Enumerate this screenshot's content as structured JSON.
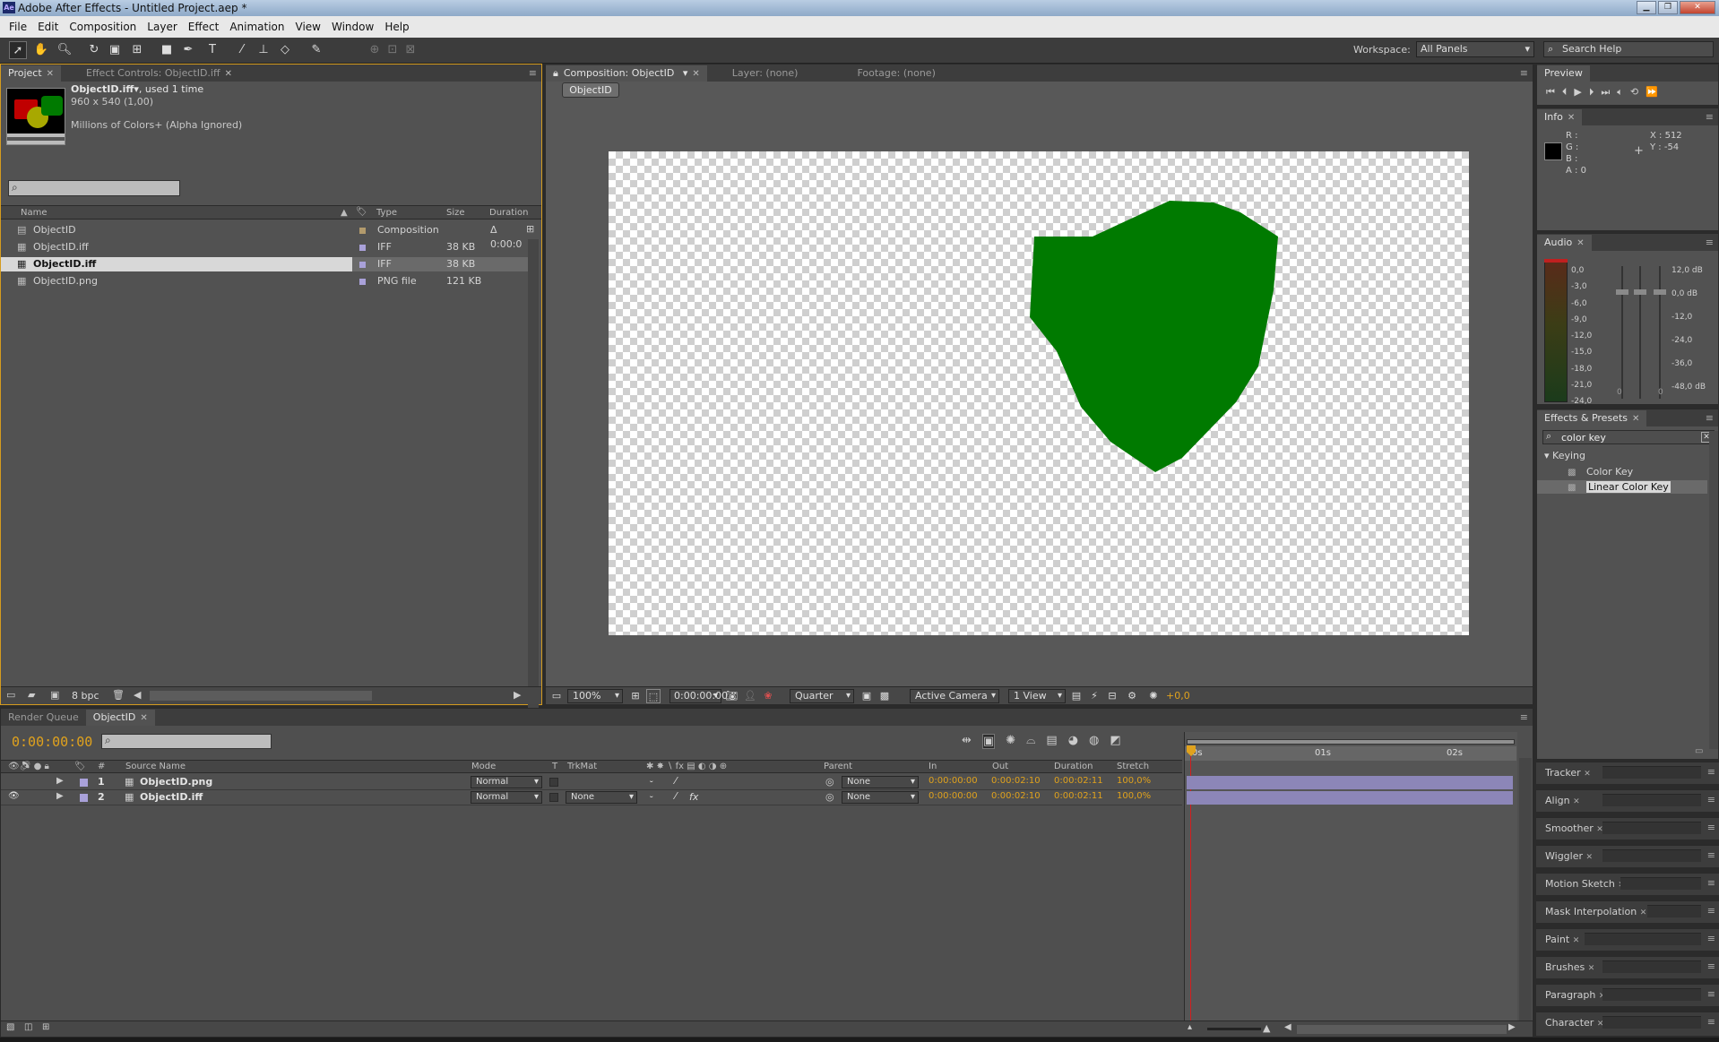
{
  "window": {
    "app_icon": "Ae",
    "title": "Adobe After Effects - Untitled Project.aep *",
    "controls": [
      "minimize",
      "restore",
      "close"
    ]
  },
  "menu": [
    "File",
    "Edit",
    "Composition",
    "Layer",
    "Effect",
    "Animation",
    "View",
    "Window",
    "Help"
  ],
  "toolbar": {
    "tools": [
      "selection-tool",
      "hand-tool",
      "zoom-tool",
      "rotation-tool",
      "camera-orbit-tool",
      "pan-behind-tool",
      "rectangle-tool",
      "pen-tool",
      "type-tool",
      "brush-tool",
      "clone-stamp-tool",
      "eraser-tool",
      "puppet-pin-tool"
    ],
    "workspace_label": "Workspace:",
    "workspace_value": "All Panels",
    "search_placeholder": "Search Help"
  },
  "project_panel": {
    "tabs": [
      "Project",
      "Effect Controls: ObjectID.iff"
    ],
    "selected_name": "ObjectID.iff▾",
    "used_text": ", used 1 time",
    "dimensions": "960 x 540 (1,00)",
    "color_info": "Millions of Colors+ (Alpha Ignored)",
    "columns": {
      "name": "Name",
      "type": "Type",
      "size": "Size",
      "duration": "Duration"
    },
    "items": [
      {
        "name": "ObjectID",
        "type": "Composition",
        "size": "",
        "duration": "Δ 0:00:0",
        "label_color": "#b29a6c",
        "icon": "composition-icon"
      },
      {
        "name": "ObjectID.iff",
        "type": "IFF",
        "size": "38 KB",
        "duration": "",
        "label_color": "#a9a1d9",
        "icon": "footage-icon"
      },
      {
        "name": "ObjectID.iff",
        "type": "IFF",
        "size": "38 KB",
        "duration": "",
        "label_color": "#a9a1d9",
        "icon": "footage-icon",
        "selected": true
      },
      {
        "name": "ObjectID.png",
        "type": "PNG file",
        "size": "121 KB",
        "duration": "",
        "label_color": "#a9a1d9",
        "icon": "footage-icon"
      }
    ],
    "bpc": "8 bpc"
  },
  "composition_panel": {
    "tabs": [
      "Composition: ObjectID",
      "Layer: (none)",
      "Footage: (none)"
    ],
    "breadcrumb": "ObjectID",
    "zoom": "100%",
    "timecode": "0:00:00:00",
    "resolution": "Quarter",
    "camera": "Active Camera",
    "views": "1 View",
    "exposure": "+0,0",
    "shape_color": "#007a00"
  },
  "preview_panel": {
    "tab": "Preview"
  },
  "info_panel": {
    "tab": "Info",
    "r": "R :",
    "g": "G :",
    "b": "B :",
    "a": "A : 0",
    "x": "X : 512",
    "y": "Y : -54"
  },
  "audio_panel": {
    "tab": "Audio",
    "left_scale": [
      "0,0",
      "-3,0",
      "-6,0",
      "-9,0",
      "-12,0",
      "-15,0",
      "-18,0",
      "-21,0",
      "-24,0"
    ],
    "right_scale": [
      "12,0 dB",
      "0,0 dB",
      "-12,0",
      "-24,0",
      "-36,0",
      "-48,0 dB"
    ],
    "slider_values": [
      "0",
      "0"
    ]
  },
  "effects_panel": {
    "tab": "Effects & Presets",
    "search": "color key",
    "category": "Keying",
    "items": [
      "Color Key",
      "Linear Color Key"
    ]
  },
  "collapsed_panels": [
    "Tracker",
    "Align",
    "Smoother",
    "Wiggler",
    "Motion Sketch",
    "Mask Interpolation",
    "Paint",
    "Brushes",
    "Paragraph",
    "Character"
  ],
  "timeline": {
    "tabs": [
      "Render Queue",
      "ObjectID"
    ],
    "current_time": "0:00:00:00",
    "columns": {
      "source": "Source Name",
      "mode": "Mode",
      "t": "T",
      "trkmat": "TrkMat",
      "parent": "Parent",
      "in": "In",
      "out": "Out",
      "duration": "Duration",
      "stretch": "Stretch",
      "num": "#"
    },
    "ruler": [
      "0s",
      "01s",
      "02s"
    ],
    "layers": [
      {
        "num": "1",
        "name": "ObjectID.png",
        "mode": "Normal",
        "trkmat": "",
        "parent": "None",
        "in": "0:00:00:00",
        "out": "0:00:02:10",
        "duration": "0:00:02:11",
        "stretch": "100,0%",
        "fx": false
      },
      {
        "num": "2",
        "name": "ObjectID.iff",
        "mode": "Normal",
        "trkmat": "None",
        "parent": "None",
        "in": "0:00:00:00",
        "out": "0:00:02:10",
        "duration": "0:00:02:11",
        "stretch": "100,0%",
        "fx": true
      }
    ]
  }
}
